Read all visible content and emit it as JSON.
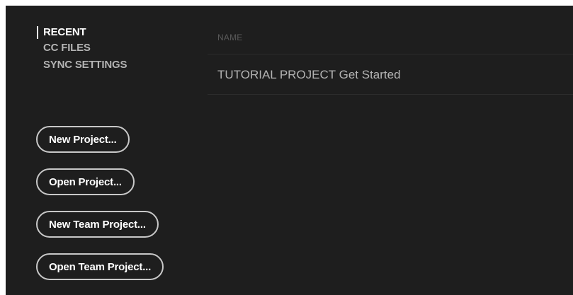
{
  "sidebar": {
    "nav": [
      {
        "label": "RECENT",
        "active": true
      },
      {
        "label": "CC FILES",
        "active": false
      },
      {
        "label": "SYNC SETTINGS",
        "active": false
      }
    ],
    "buttons": {
      "new_project": "New Project...",
      "open_project": "Open Project...",
      "new_team_project": "New Team Project...",
      "open_team_project": "Open Team Project..."
    }
  },
  "main": {
    "columns": {
      "name": "NAME"
    },
    "rows": [
      {
        "name": "TUTORIAL PROJECT Get Started"
      }
    ]
  },
  "colors": {
    "background": "#1e1e1e",
    "text_active": "#ffffff",
    "text_muted": "#b3b3b3",
    "header_text": "#5a5a5a",
    "button_border": "#c8c8c8",
    "divider": "#2c2c2c"
  }
}
